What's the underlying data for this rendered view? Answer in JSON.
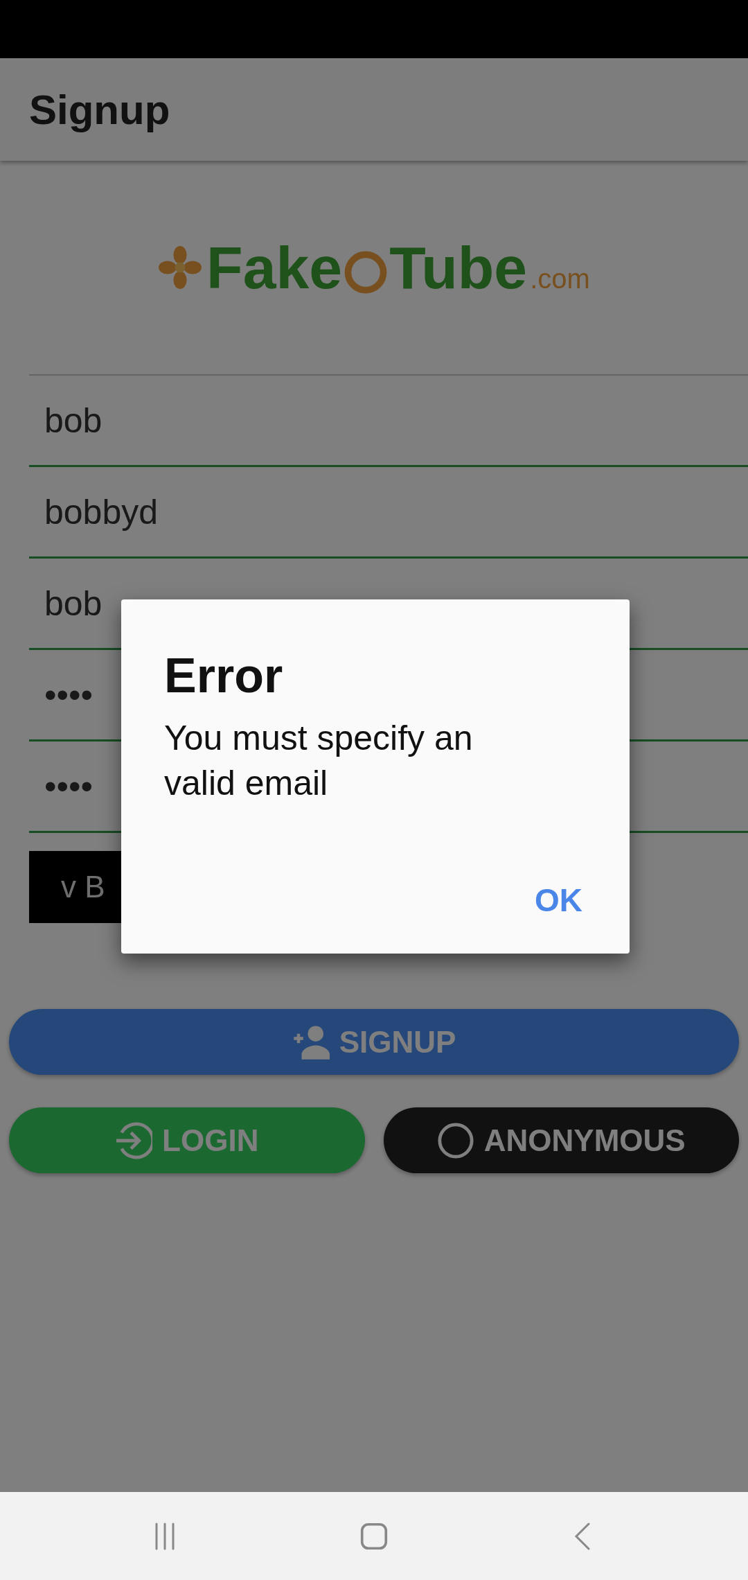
{
  "app_bar": {
    "title": "Signup"
  },
  "logo": {
    "name_start": "Fake",
    "name_end": "Tube",
    "suffix": ".com"
  },
  "fields": [
    {
      "value": "bob"
    },
    {
      "value": "bobbyd"
    },
    {
      "value": "bob"
    },
    {
      "value": "••••"
    },
    {
      "value": "••••"
    }
  ],
  "dark_banner": {
    "text": "v B"
  },
  "buttons": [
    {
      "kind": "signup",
      "label": "SIGNUP"
    },
    {
      "kind": "login",
      "label": "LOGIN"
    },
    {
      "kind": "anonymous",
      "label": "ANONYMOUS"
    }
  ],
  "dialog": {
    "title": "Error",
    "message": "You must specify an valid email",
    "button": "OK"
  }
}
